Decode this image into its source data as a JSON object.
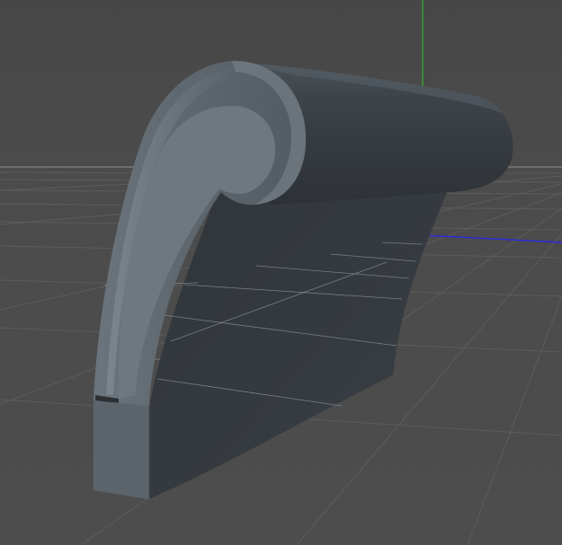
{
  "viewport": {
    "background": "#4b4b4b",
    "grid_color": "#5c5c5c",
    "horizon_color": "#6a6a6a"
  },
  "axes": {
    "y_axis_color": "#2fb32f",
    "x_axis_color": "#2a2ae0",
    "origin_marker_color": "#b03030"
  },
  "model": {
    "shape": "curled-armrest",
    "body_color": "#383d42",
    "side_color": "#5a636b",
    "highlight_color": "#8a949c",
    "wireframe_color": "#9aa3aa"
  }
}
